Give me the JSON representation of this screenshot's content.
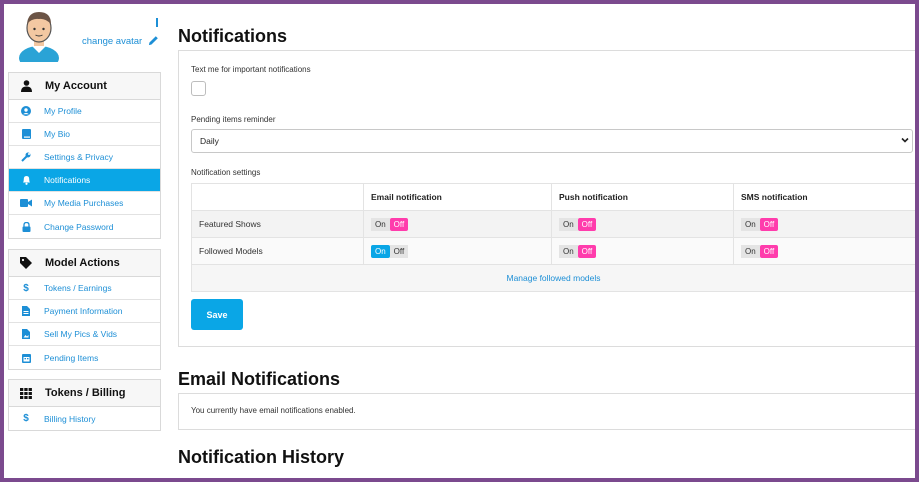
{
  "profile": {
    "change_avatar_label": "change avatar"
  },
  "sidebar": {
    "sections": [
      {
        "title": "My Account",
        "icon": "user-icon",
        "items": [
          {
            "label": "My Profile",
            "icon": "user-circle-icon",
            "active": false
          },
          {
            "label": "My Bio",
            "icon": "book-icon",
            "active": false
          },
          {
            "label": "Settings & Privacy",
            "icon": "wrench-icon",
            "active": false
          },
          {
            "label": "Notifications",
            "icon": "bell-icon",
            "active": true
          },
          {
            "label": "My Media Purchases",
            "icon": "video-camera-icon",
            "active": false
          },
          {
            "label": "Change Password",
            "icon": "lock-icon",
            "active": false
          }
        ]
      },
      {
        "title": "Model Actions",
        "icon": "tag-icon",
        "items": [
          {
            "label": "Tokens / Earnings",
            "icon": "dollar-icon",
            "active": false
          },
          {
            "label": "Payment Information",
            "icon": "file-icon",
            "active": false
          },
          {
            "label": "Sell My Pics & Vids",
            "icon": "image-file-icon",
            "active": false
          },
          {
            "label": "Pending Items",
            "icon": "calendar-icon",
            "active": false
          }
        ]
      },
      {
        "title": "Tokens / Billing",
        "icon": "grid-icon",
        "items": [
          {
            "label": "Billing History",
            "icon": "dollar-icon",
            "active": false
          }
        ]
      }
    ]
  },
  "notifications": {
    "title": "Notifications",
    "text_me_label": "Text me for important notifications",
    "text_me_checked": false,
    "pending_label": "Pending items reminder",
    "pending_value": "Daily",
    "settings_label": "Notification settings",
    "columns": [
      "Email notification",
      "Push notification",
      "SMS notification"
    ],
    "rows": [
      {
        "label": "Featured Shows",
        "email": "off",
        "push": "off",
        "sms": "off"
      },
      {
        "label": "Followed Models",
        "email": "on",
        "push": "off",
        "sms": "off"
      }
    ],
    "on_label": "On",
    "off_label": "Off",
    "manage_link": "Manage followed models",
    "save_label": "Save"
  },
  "email_notifications": {
    "title": "Email Notifications",
    "status_text": "You currently have email notifications enabled."
  },
  "history": {
    "title": "Notification History"
  },
  "colors": {
    "accent": "#0aa6e6",
    "toggle_off_active": "#ff3cac",
    "frame": "#7b4a8e"
  }
}
